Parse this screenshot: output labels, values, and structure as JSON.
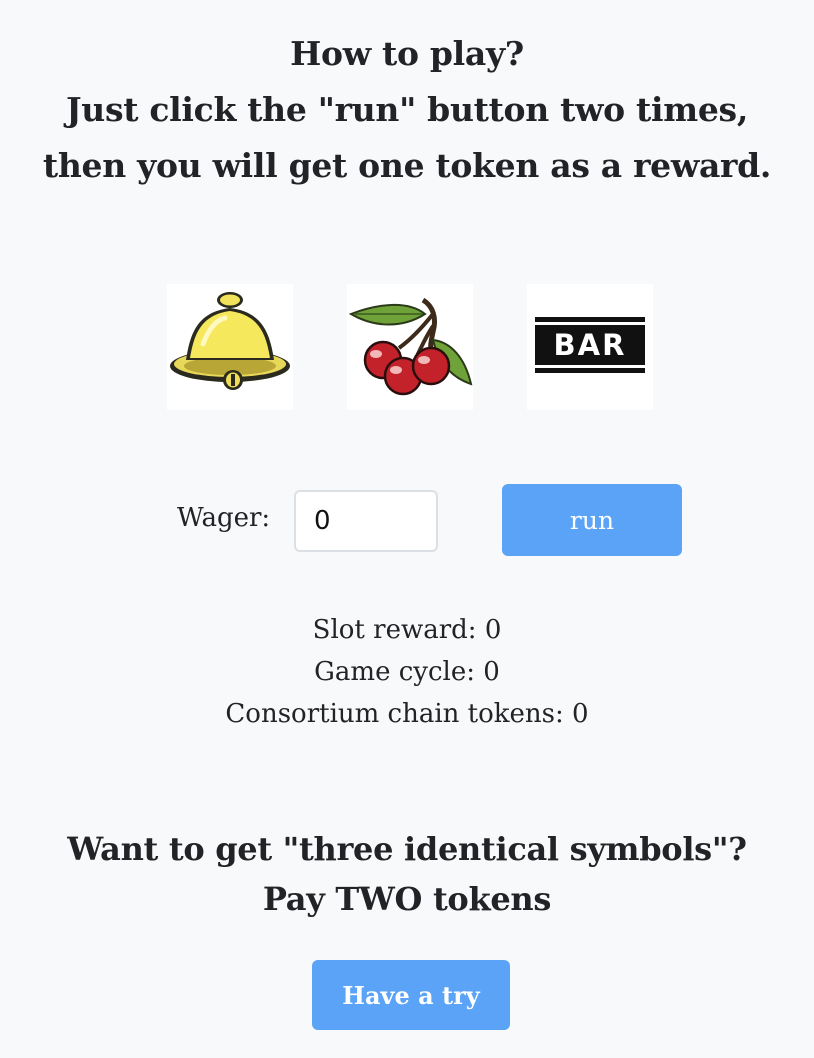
{
  "instructions": {
    "line1": "How to play?",
    "line2": "Just click the \"run\" button two times,",
    "line3": "then you will get one token as a reward."
  },
  "reels": [
    {
      "symbol": "bell-icon"
    },
    {
      "symbol": "cherry-icon"
    },
    {
      "symbol": "bar-icon",
      "text": "BAR"
    }
  ],
  "wager": {
    "label": "Wager:",
    "value": "0"
  },
  "run_button": {
    "label": "run"
  },
  "stats": {
    "slot_reward_label": "Slot reward:",
    "slot_reward_value": "0",
    "game_cycle_label": "Game cycle:",
    "game_cycle_value": "0",
    "tokens_label": "Consortium chain tokens:",
    "tokens_value": "0"
  },
  "offer": {
    "line1": "Want to get \"three identical symbols\"?",
    "line2": "Pay TWO tokens"
  },
  "try_button": {
    "label": "Have a try"
  },
  "colors": {
    "background": "#f8f9fb",
    "button": "#5ba3f6",
    "text": "#222326"
  }
}
